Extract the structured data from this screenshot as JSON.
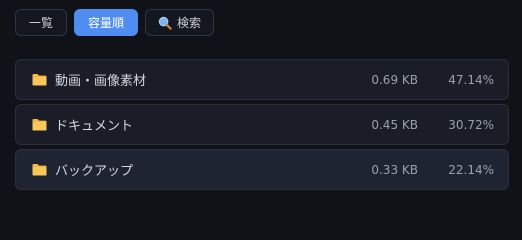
{
  "toolbar": {
    "list_label": "一覧",
    "size_order_label": "容量順",
    "search_label": "検索",
    "search_icon": "magnifier-icon",
    "accent_color": "#4f8ef0"
  },
  "items": [
    {
      "name": "動画・画像素材",
      "size": "0.69 KB",
      "percent": "47.14%",
      "icon": "folder-icon"
    },
    {
      "name": "ドキュメント",
      "size": "0.45 KB",
      "percent": "30.72%",
      "icon": "folder-icon"
    },
    {
      "name": "バックアップ",
      "size": "0.33 KB",
      "percent": "22.14%",
      "icon": "folder-icon"
    }
  ]
}
